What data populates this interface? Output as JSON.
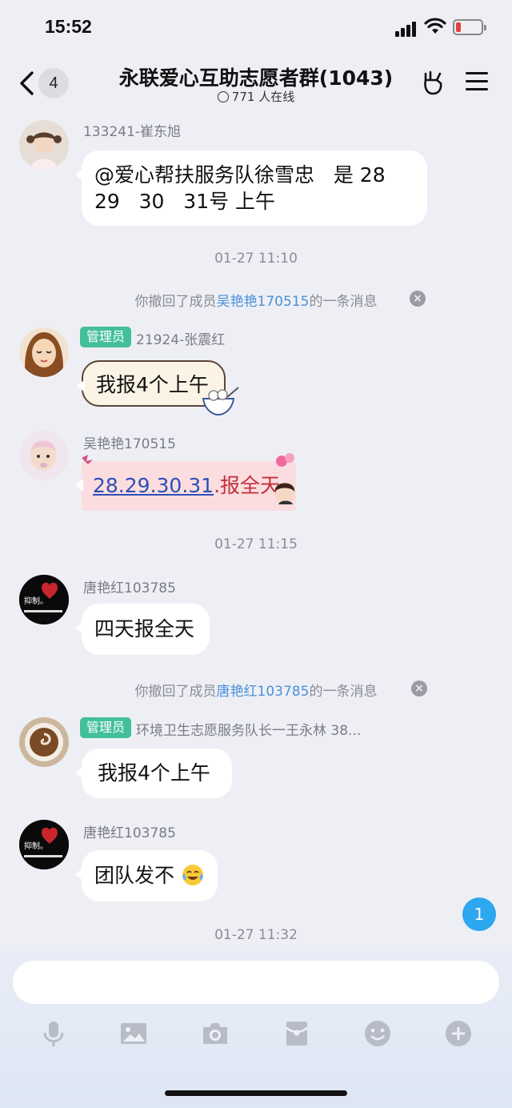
{
  "status": {
    "time": "15:52"
  },
  "header": {
    "back_badge": "4",
    "title": "永联爱心互助志愿者群(1043)",
    "online": "771 人在线"
  },
  "messages": [
    {
      "sender": "133241-崔东旭",
      "line1": "@爱心帮扶服务队徐雪忠   是 28",
      "line2": "29   30   31号 上午"
    },
    {
      "timestamp": "01-27 11:10"
    },
    {
      "recall_prefix": "你撤回了成员",
      "recall_name": "吴艳艳170515",
      "recall_suffix": "的一条消息"
    },
    {
      "admin_tag": "管理员",
      "sender": "21924-张震红",
      "text": "我报4个上午"
    },
    {
      "sender": "吴艳艳170515",
      "link": "28.29.30.31",
      "rest": ".报全天"
    },
    {
      "timestamp": "01-27 11:15"
    },
    {
      "sender": "唐艳红103785",
      "text": "四天报全天"
    },
    {
      "recall_prefix": "你撤回了成员",
      "recall_name": "唐艳红103785",
      "recall_suffix": "的一条消息"
    },
    {
      "admin_tag": "管理员",
      "sender": "环境卫生志愿服务队长一王永林 38...",
      "text": "我报4个上午"
    },
    {
      "sender": "唐艳红103785",
      "text": "团队发不"
    },
    {
      "timestamp": "01-27 11:32"
    }
  ],
  "floating_badge": "1",
  "avatar_text": "抑制。",
  "toolbar": [
    "microphone-icon",
    "image-icon",
    "camera-icon",
    "red-packet-icon",
    "emoji-icon",
    "plus-icon"
  ]
}
